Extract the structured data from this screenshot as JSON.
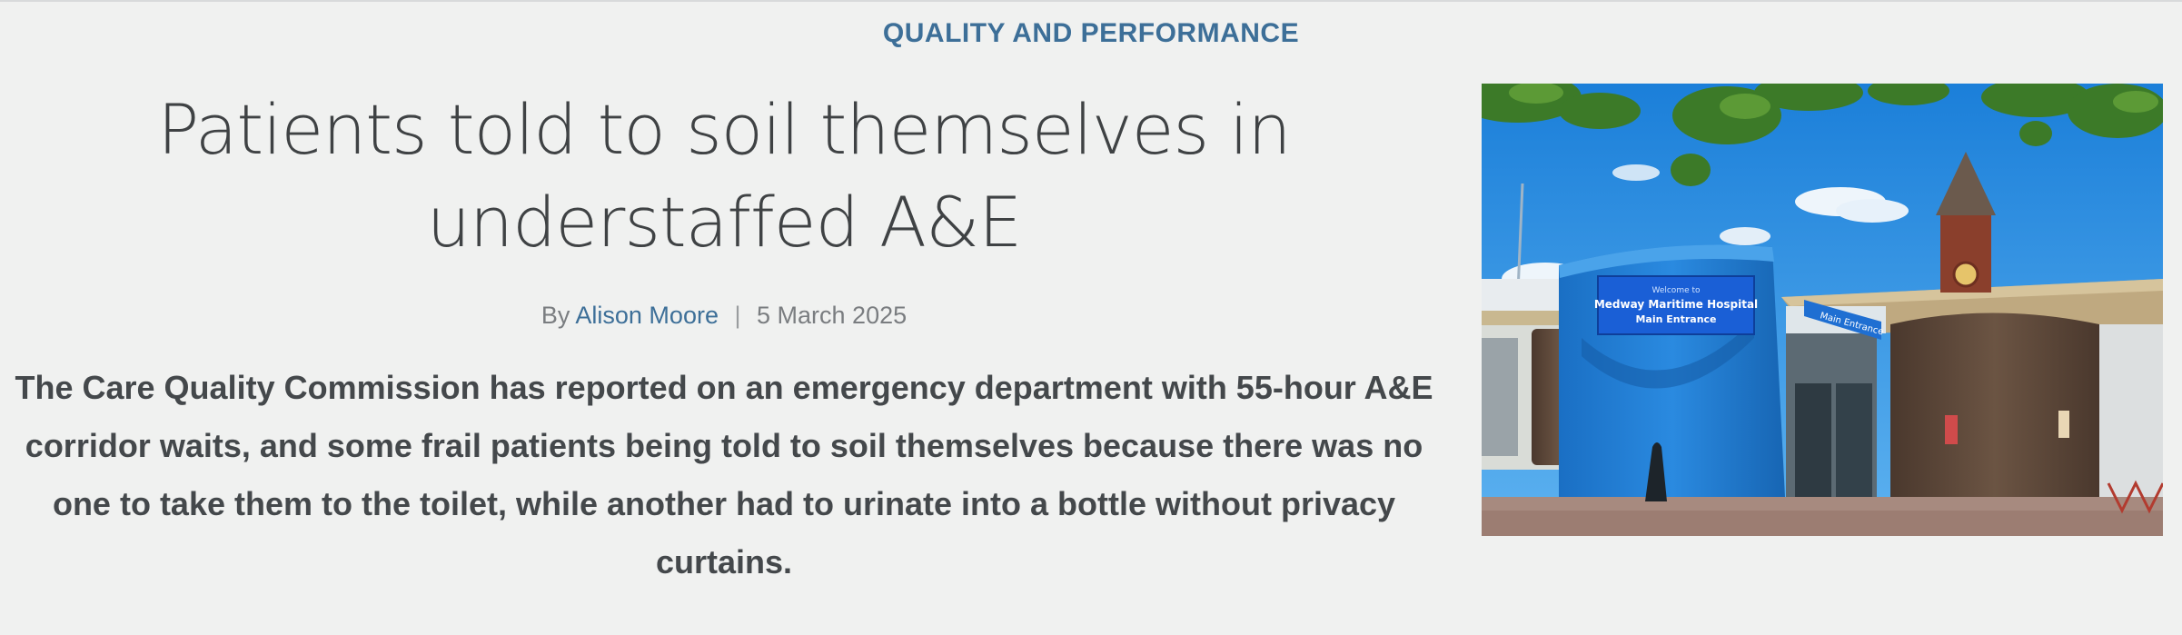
{
  "article": {
    "category": "QUALITY AND PERFORMANCE",
    "headline": "Patients told to soil themselves in understaffed A&E",
    "byline_prefix": "By",
    "author": "Alison Moore",
    "separator": "|",
    "date": "5 March 2025",
    "standfirst": "The Care Quality Commission has reported on an emergency department with 55-hour A&E corridor waits, and some frail patients being told to soil themselves because there was no one to take them to the toilet, while another had to urinate into a bottle without privacy curtains."
  },
  "photo": {
    "sign_line1": "Welcome to",
    "sign_line2": "Medway Maritime Hospital",
    "sign_line3": "Main Entrance",
    "side_sign": "Main Entrance",
    "colors": {
      "sky": "#2f8fe0",
      "building_blue": "#1f7fd4",
      "wood": "#5a4537",
      "accent": "#3d6f98"
    }
  }
}
